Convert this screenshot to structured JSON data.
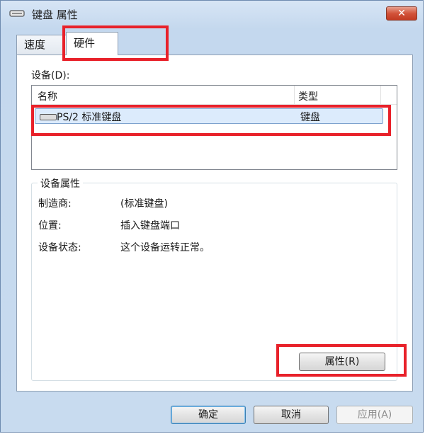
{
  "window": {
    "title": "键盘 属性",
    "close_glyph": "✕"
  },
  "tabs": [
    {
      "label": "速度",
      "selected": false
    },
    {
      "label": "硬件",
      "selected": true
    }
  ],
  "devices": {
    "label": "设备(D):",
    "columns": [
      "名称",
      "类型"
    ],
    "rows": [
      {
        "name": "PS/2 标准键盘",
        "type": "键盘",
        "selected": true
      }
    ]
  },
  "device_properties": {
    "title": "设备属性",
    "manufacturer_label": "制造商:",
    "manufacturer_value": "(标准键盘)",
    "location_label": "位置:",
    "location_value": "插入键盘端口",
    "status_label": "设备状态:",
    "status_value": "这个设备运转正常。",
    "properties_button": "属性(R)"
  },
  "footer": {
    "ok": "确定",
    "cancel": "取消",
    "apply": "应用(A)"
  },
  "colors": {
    "highlight_box": "#e8212a",
    "title_gradient": "#c4d8ee",
    "close_button": "#d2533a"
  }
}
